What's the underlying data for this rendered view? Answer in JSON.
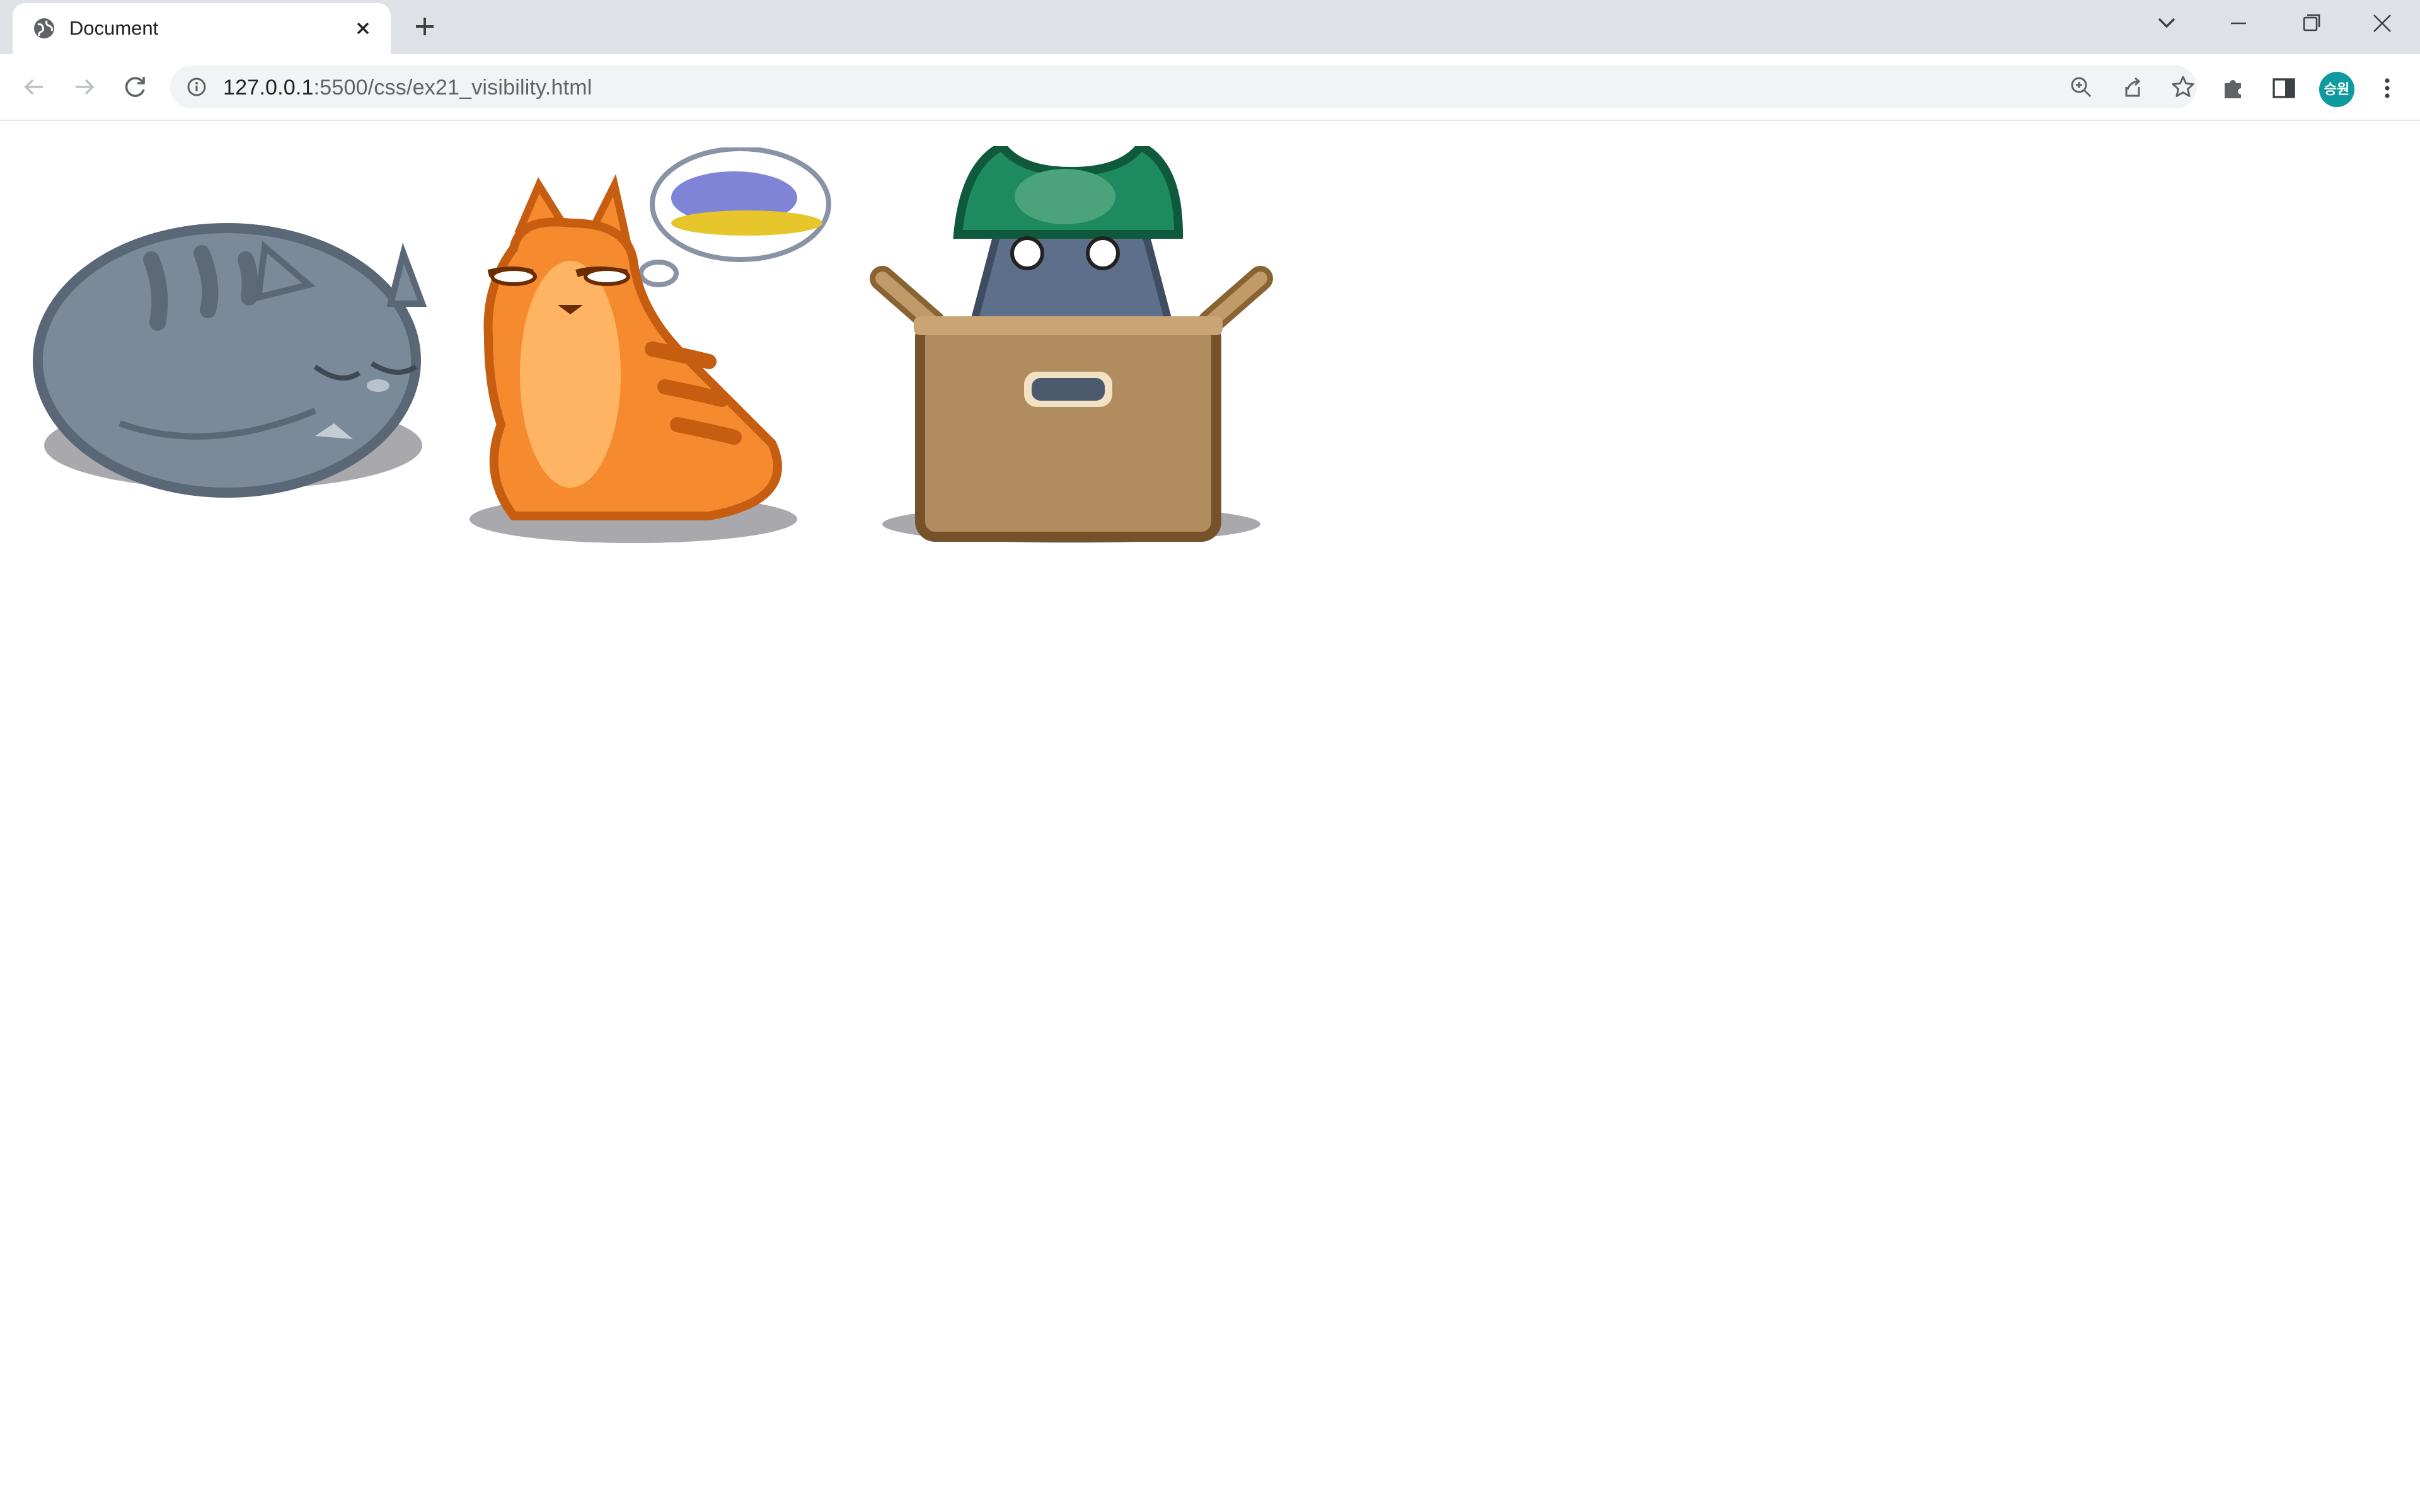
{
  "browser": {
    "tab_title": "Document",
    "url_host": "127.0.0.1",
    "url_path": ":5500/css/ex21_visibility.html",
    "profile_initials": "승원",
    "profile_color": "#0e9aa0"
  },
  "icons": {
    "tab": [
      "globe-icon",
      "close-icon",
      "plus-icon"
    ],
    "window": [
      "chevron-down-icon",
      "minimize-icon",
      "restore-icon",
      "close-icon"
    ],
    "nav": [
      "back-arrow-icon",
      "forward-arrow-icon",
      "reload-icon",
      "info-icon"
    ],
    "omnibox_actions": [
      "zoom-icon",
      "share-icon",
      "star-icon"
    ],
    "toolbar_actions": [
      "extensions-puzzle-icon",
      "side-panel-icon",
      "kebab-menu-icon"
    ]
  },
  "images": [
    {
      "name": "sleeping-gray-cat",
      "color": "#7b8a9a"
    },
    {
      "name": "orange-cat-thinking",
      "color": "#f58a2e"
    },
    {
      "name": "cat-in-box-with-helmet",
      "color": "#b08c5e"
    }
  ]
}
